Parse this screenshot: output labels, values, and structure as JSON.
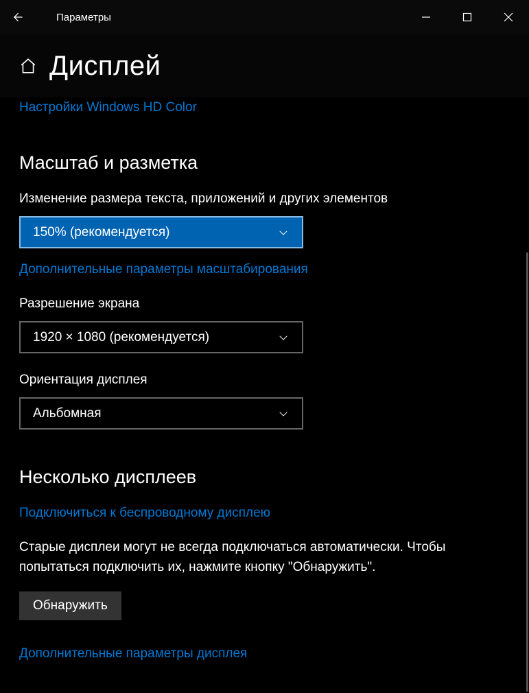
{
  "titlebar": {
    "title": "Параметры"
  },
  "page": {
    "title": "Дисплей"
  },
  "links": {
    "hd_color": "Настройки Windows HD Color",
    "advanced_scaling": "Дополнительные параметры масштабирования",
    "wireless_display": "Подключиться к беспроводному дисплею",
    "advanced_display": "Дополнительные параметры дисплея"
  },
  "sections": {
    "scale": {
      "heading": "Масштаб и разметка",
      "scale_label": "Изменение размера текста, приложений и других элементов",
      "scale_value": "150% (рекомендуется)",
      "resolution_label": "Разрешение экрана",
      "resolution_value": "1920 × 1080 (рекомендуется)",
      "orientation_label": "Ориентация дисплея",
      "orientation_value": "Альбомная"
    },
    "multi": {
      "heading": "Несколько дисплеев",
      "detect_text": "Старые дисплеи могут не всегда подключаться автоматически. Чтобы попытаться подключить их, нажмите кнопку \"Обнаружить\".",
      "detect_button": "Обнаружить"
    }
  }
}
